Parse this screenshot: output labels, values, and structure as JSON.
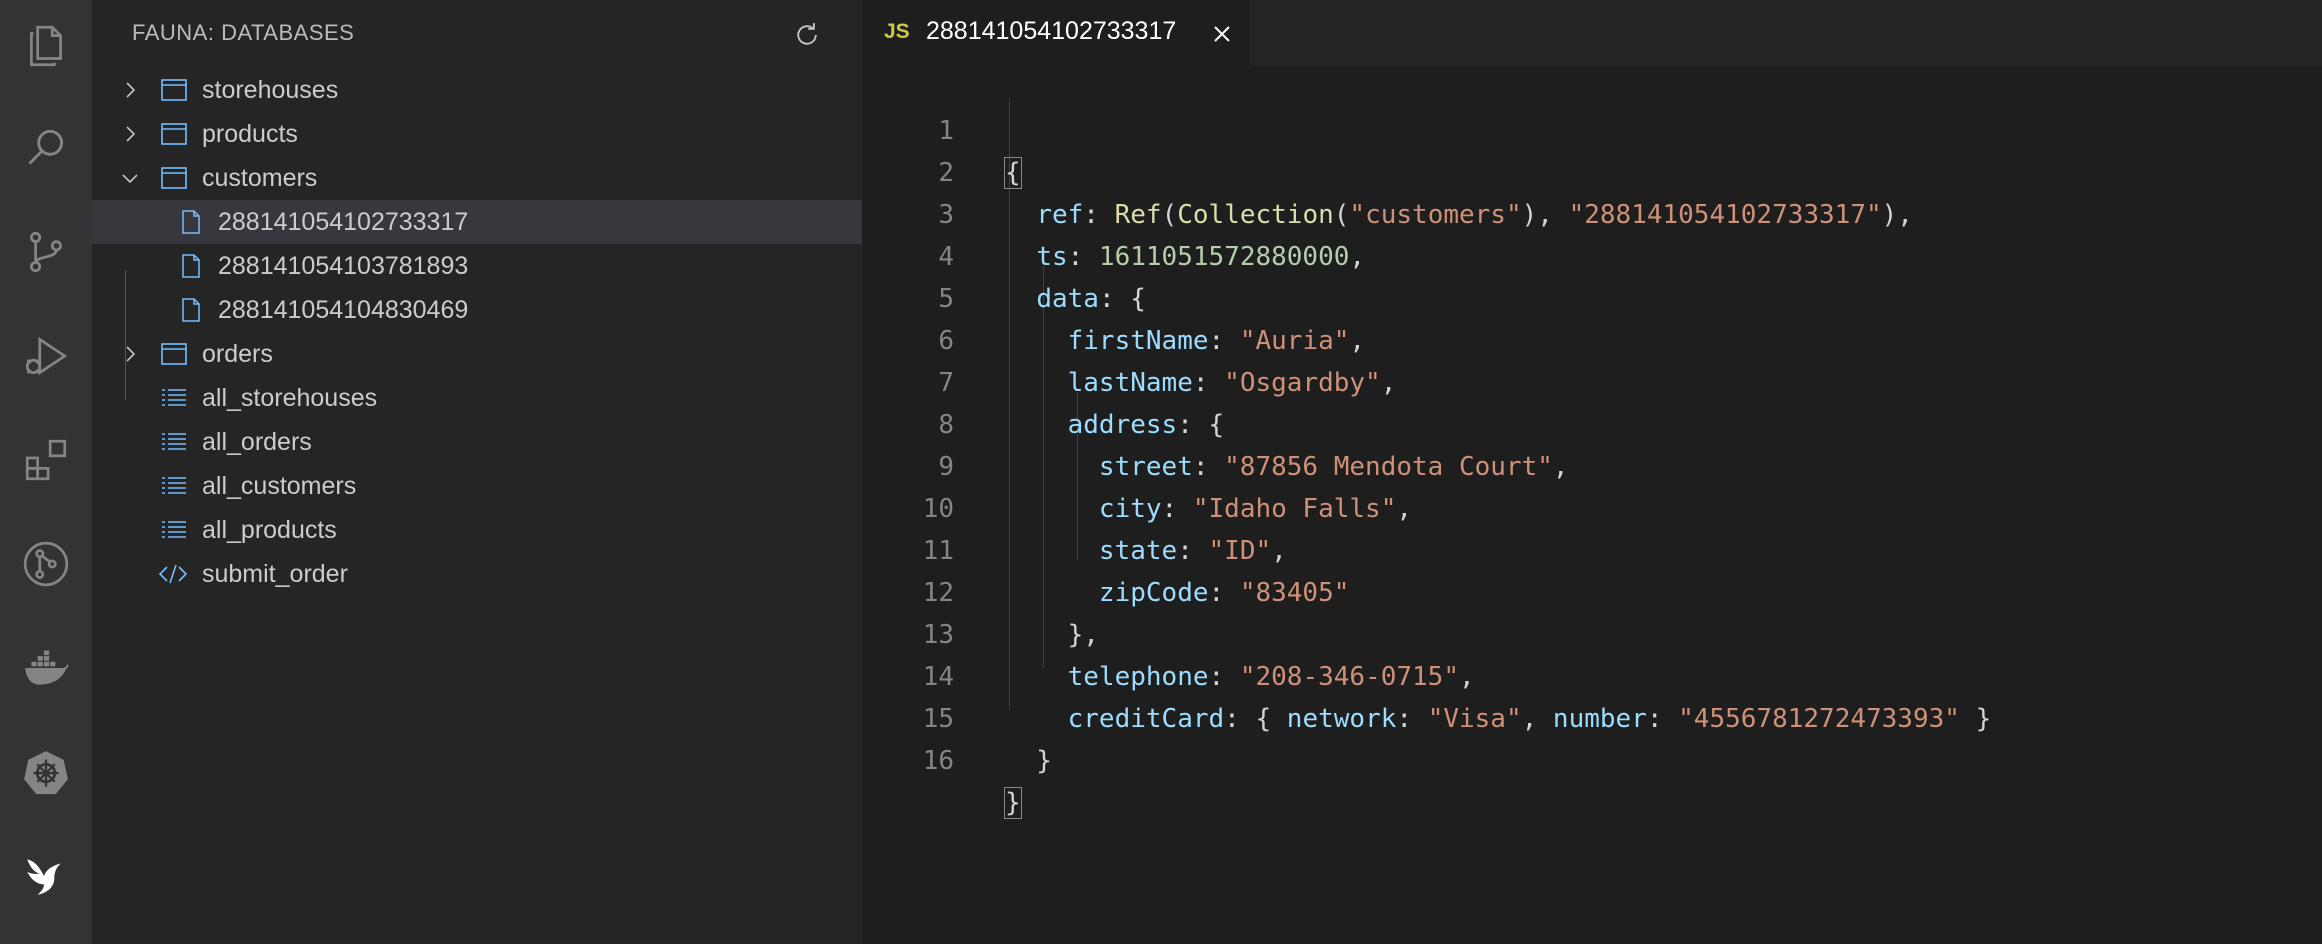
{
  "activity_bar": {
    "icons": [
      "files-icon",
      "search-icon",
      "source-control-icon",
      "run-debug-icon",
      "extensions-icon",
      "git-graph-icon",
      "docker-icon",
      "kubernetes-icon",
      "fauna-icon"
    ]
  },
  "sidebar": {
    "title": "FAUNA: DATABASES",
    "items": [
      {
        "label": "storehouses",
        "type": "collection",
        "expanded": false
      },
      {
        "label": "products",
        "type": "collection",
        "expanded": false
      },
      {
        "label": "customers",
        "type": "collection",
        "expanded": true
      },
      {
        "label": "288141054102733317",
        "type": "document",
        "selected": true
      },
      {
        "label": "288141054103781893",
        "type": "document"
      },
      {
        "label": "288141054104830469",
        "type": "document"
      },
      {
        "label": "orders",
        "type": "collection",
        "expanded": false
      },
      {
        "label": "all_storehouses",
        "type": "index"
      },
      {
        "label": "all_orders",
        "type": "index"
      },
      {
        "label": "all_customers",
        "type": "index"
      },
      {
        "label": "all_products",
        "type": "index"
      },
      {
        "label": "submit_order",
        "type": "function"
      }
    ]
  },
  "editor": {
    "tab": {
      "badge": "JS",
      "title": "288141054102733317"
    },
    "line_numbers": [
      "1",
      "2",
      "3",
      "4",
      "5",
      "6",
      "7",
      "8",
      "9",
      "10",
      "11",
      "12",
      "13",
      "14",
      "15",
      "16"
    ],
    "code": {
      "l1_brace": "{",
      "ref_key": "ref",
      "ref_fn": "Ref",
      "collection_fn": "Collection",
      "collection_name": "\"customers\"",
      "ref_id": "\"288141054102733317\"",
      "ts_key": "ts",
      "ts_value": "1611051572880000",
      "data_key": "data",
      "firstName_key": "firstName",
      "firstName_value": "\"Auria\"",
      "lastName_key": "lastName",
      "lastName_value": "\"Osgardby\"",
      "address_key": "address",
      "street_key": "street",
      "street_value": "\"87856 Mendota Court\"",
      "city_key": "city",
      "city_value": "\"Idaho Falls\"",
      "state_key": "state",
      "state_value": "\"ID\"",
      "zip_key": "zipCode",
      "zip_value": "\"83405\"",
      "telephone_key": "telephone",
      "telephone_value": "\"208-346-0715\"",
      "creditCard_key": "creditCard",
      "network_key": "network",
      "network_value": "\"Visa\"",
      "number_key": "number",
      "number_value": "\"4556781272473393\"",
      "l16_brace": "}"
    }
  },
  "colors": {
    "activity_bg": "#333333",
    "sidebar_bg": "#252526",
    "editor_bg": "#1e1e1e",
    "selection_bg": "#37373d",
    "key": "#9cdcfe",
    "string": "#ce9178",
    "number": "#b5cea8",
    "function": "#dcdcaa",
    "js_badge": "#cbcb41"
  }
}
